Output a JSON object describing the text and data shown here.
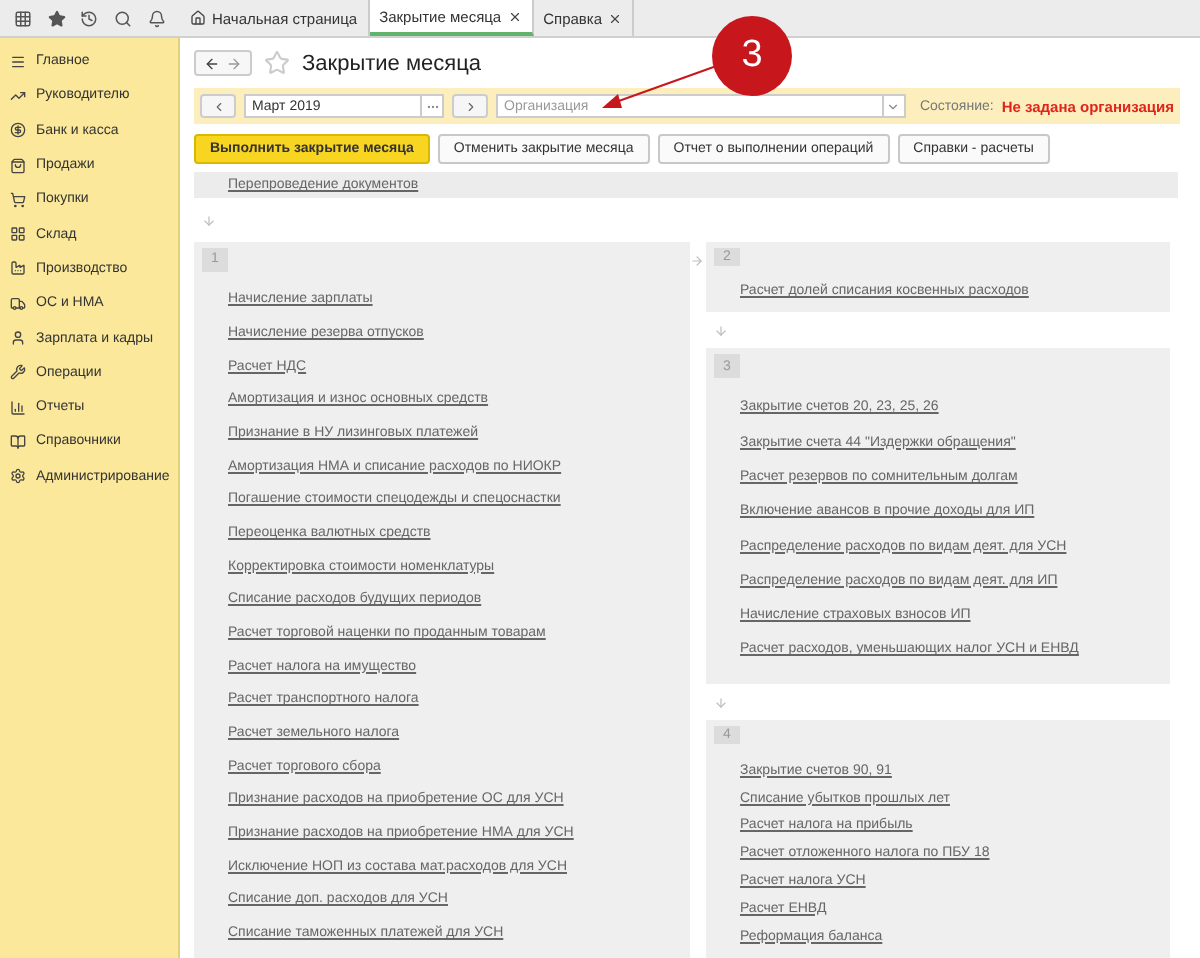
{
  "tabs": [
    {
      "label": "Начальная страница",
      "kind": "home",
      "selected": false
    },
    {
      "label": "Закрытие месяца",
      "kind": "doc",
      "selected": true
    },
    {
      "label": "Справка",
      "kind": "doc",
      "selected": false
    }
  ],
  "sidebar": {
    "items": [
      {
        "label": "Главное"
      },
      {
        "label": "Руководителю"
      },
      {
        "label": "Банк и касса"
      },
      {
        "label": "Продажи"
      },
      {
        "label": "Покупки"
      },
      {
        "label": "Склад"
      },
      {
        "label": "Производство"
      },
      {
        "label": "ОС и НМА"
      },
      {
        "label": "Зарплата и кадры"
      },
      {
        "label": "Операции"
      },
      {
        "label": "Отчеты"
      },
      {
        "label": "Справочники"
      },
      {
        "label": "Администрирование"
      }
    ]
  },
  "form": {
    "title": "Закрытие месяца",
    "favorite": false,
    "period": {
      "value": "Март 2019"
    },
    "organization": {
      "placeholder": "Организация"
    },
    "status_label": "Состояние:",
    "status": "Не задана организация",
    "buttons": [
      {
        "label": "Выполнить закрытие месяца",
        "primary": true
      },
      {
        "label": "Отменить закрытие месяца",
        "primary": false
      },
      {
        "label": "Отчет о выполнении операций",
        "primary": false
      },
      {
        "label": "Справки - расчеты",
        "primary": false
      }
    ],
    "pre_step": "Перепроведение документов",
    "left_groups": [
      {
        "number": "1",
        "items": [
          "Начисление зарплаты",
          "Начисление резерва отпусков",
          "Расчет НДС",
          "Амортизация и износ основных средств",
          "Признание в НУ лизинговых платежей",
          "Амортизация НМА и списание расходов по НИОКР",
          "Погашение стоимости спецодежды и спецоснастки",
          "Переоценка валютных средств",
          "Корректировка стоимости номенклатуры",
          "Списание расходов будущих периодов",
          "Расчет торговой наценки по проданным товарам",
          "Расчет налога на имущество",
          "Расчет транспортного налога",
          "Расчет земельного налога",
          "Расчет торгового сбора",
          "Признание расходов на приобретение ОС для УСН",
          "Признание расходов на приобретение НМА для УСН",
          "Исключение НОП из состава мат.расходов для УСН",
          "Списание доп. расходов для УСН",
          "Списание таможенных платежей для УСН"
        ]
      }
    ],
    "right_groups": [
      {
        "number": "2",
        "items": [
          "Расчет долей списания косвенных расходов"
        ]
      },
      {
        "number": "3",
        "items": [
          "Закрытие счетов 20, 23, 25, 26",
          "Закрытие счета 44 \"Издержки обращения\"",
          "Расчет резервов по сомнительным долгам",
          "Включение авансов в прочие доходы для ИП",
          "Распределение расходов по видам деят. для УСН",
          "Распределение расходов по видам деят. для ИП",
          "Начисление страховых взносов ИП",
          "Расчет расходов, уменьшающих налог УСН и ЕНВД"
        ]
      },
      {
        "number": "4",
        "items": [
          "Закрытие счетов 90, 91",
          "Списание убытков прошлых лет",
          "Расчет налога на прибыль",
          "Расчет отложенного налога по ПБУ 18",
          "Расчет налога УСН",
          "Расчет ЕНВД",
          "Реформация баланса"
        ]
      }
    ]
  },
  "annotation": {
    "label": "3"
  }
}
